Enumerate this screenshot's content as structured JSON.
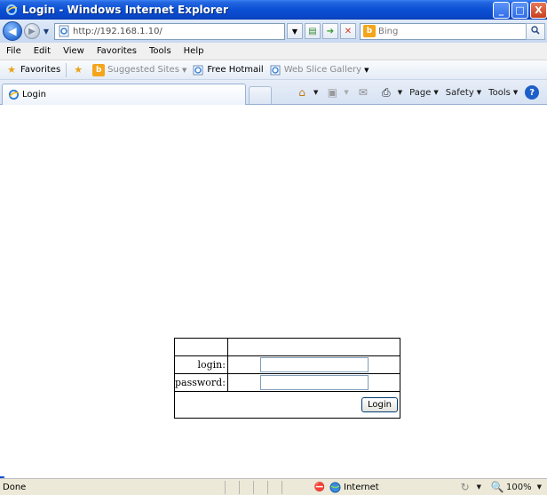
{
  "window": {
    "title": "Login - Windows Internet Explorer",
    "min_label": "_",
    "max_label": "□",
    "close_label": "X"
  },
  "address": {
    "url": "http://192.168.1.10/",
    "search_placeholder": "Bing"
  },
  "menu": [
    "File",
    "Edit",
    "View",
    "Favorites",
    "Tools",
    "Help"
  ],
  "favorites_bar": {
    "favorites_label": "Favorites",
    "suggested_sites": "Suggested Sites",
    "free_hotmail": "Free Hotmail",
    "web_slice_gallery": "Web Slice Gallery"
  },
  "tab": {
    "title": "Login"
  },
  "command_bar": {
    "page": "Page",
    "safety": "Safety",
    "tools": "Tools"
  },
  "login_form": {
    "login_label": "login:",
    "password_label": "password:",
    "login_value": "",
    "password_value": "",
    "submit_label": "Login"
  },
  "statusbar": {
    "status": "Done",
    "zone": "Internet",
    "zoom": "100%"
  },
  "colors": {
    "title_bar": "#0a4fd4",
    "status_bar": "#ece9d8"
  }
}
